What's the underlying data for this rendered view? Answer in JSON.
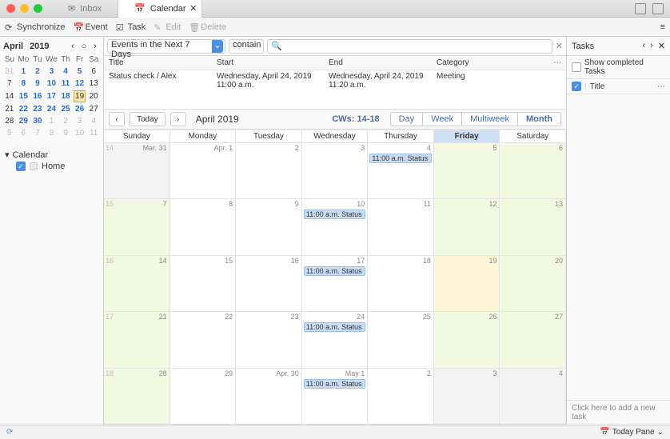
{
  "tabs": {
    "inbox": "Inbox",
    "calendar": "Calendar"
  },
  "toolbar": {
    "sync": "Synchronize",
    "event": "Event",
    "task": "Task",
    "edit": "Edit",
    "delete": "Delete"
  },
  "mini": {
    "month": "April",
    "year": "2019",
    "dow": [
      "Su",
      "Mo",
      "Tu",
      "We",
      "Th",
      "Fr",
      "Sa"
    ],
    "rows": [
      [
        {
          "d": "31",
          "dim": true
        },
        {
          "d": "1",
          "blue": true
        },
        {
          "d": "2",
          "blue": true
        },
        {
          "d": "3",
          "blue": true
        },
        {
          "d": "4",
          "blue": true
        },
        {
          "d": "5",
          "blue": true
        },
        {
          "d": "6"
        }
      ],
      [
        {
          "d": "7"
        },
        {
          "d": "8",
          "blue": true
        },
        {
          "d": "9",
          "blue": true
        },
        {
          "d": "10",
          "blue": true
        },
        {
          "d": "11",
          "blue": true
        },
        {
          "d": "12",
          "blue": true
        },
        {
          "d": "13"
        }
      ],
      [
        {
          "d": "14"
        },
        {
          "d": "15",
          "blue": true
        },
        {
          "d": "16",
          "blue": true
        },
        {
          "d": "17",
          "blue": true
        },
        {
          "d": "18",
          "blue": true
        },
        {
          "d": "19",
          "today": true
        },
        {
          "d": "20"
        }
      ],
      [
        {
          "d": "21"
        },
        {
          "d": "22",
          "blue": true
        },
        {
          "d": "23",
          "blue": true
        },
        {
          "d": "24",
          "blue": true
        },
        {
          "d": "25",
          "blue": true
        },
        {
          "d": "26",
          "blue": true
        },
        {
          "d": "27"
        }
      ],
      [
        {
          "d": "28"
        },
        {
          "d": "29",
          "blue": true
        },
        {
          "d": "30",
          "blue": true
        },
        {
          "d": "1",
          "dim": true
        },
        {
          "d": "2",
          "dim": true
        },
        {
          "d": "3",
          "dim": true
        },
        {
          "d": "4",
          "dim": true
        }
      ],
      [
        {
          "d": "5",
          "dim": true
        },
        {
          "d": "6",
          "dim": true
        },
        {
          "d": "7",
          "dim": true
        },
        {
          "d": "8",
          "dim": true
        },
        {
          "d": "9",
          "dim": true
        },
        {
          "d": "10",
          "dim": true
        },
        {
          "d": "11",
          "dim": true
        }
      ]
    ]
  },
  "sidebar": {
    "calendar_label": "Calendar",
    "home": "Home"
  },
  "filter": {
    "range": "Events in the Next 7 Days",
    "op": "contain",
    "search_placeholder": ""
  },
  "evlist": {
    "headers": {
      "title": "Title",
      "start": "Start",
      "end": "End",
      "category": "Category"
    },
    "rows": [
      {
        "title": "Status check / Alex",
        "start": "Wednesday, April 24, 2019 11:00 a.m.",
        "end": "Wednesday, April 24, 2019 11:20 a.m.",
        "category": "Meeting"
      }
    ]
  },
  "nav": {
    "today": "Today",
    "month_label": "April 2019",
    "cw": "CWs: 14-18",
    "views": {
      "day": "Day",
      "week": "Week",
      "multiweek": "Multiweek",
      "month": "Month"
    }
  },
  "grid": {
    "dow": [
      "Sunday",
      "Monday",
      "Tuesday",
      "Wednesday",
      "Thursday",
      "Friday",
      "Saturday"
    ],
    "weeks": [
      {
        "wn": "14",
        "cells": [
          {
            "d": "Mar. 31",
            "dim": true
          },
          {
            "d": "Apr. 1"
          },
          {
            "d": "2"
          },
          {
            "d": "3"
          },
          {
            "d": "4",
            "ev": "11:00 a.m. Status …"
          },
          {
            "d": "5",
            "green": true
          },
          {
            "d": "6",
            "green": true
          }
        ]
      },
      {
        "wn": "15",
        "cells": [
          {
            "d": "7",
            "green": true
          },
          {
            "d": "8"
          },
          {
            "d": "9"
          },
          {
            "d": "10",
            "ev": "11:00 a.m. Status …"
          },
          {
            "d": "11"
          },
          {
            "d": "12",
            "green": true
          },
          {
            "d": "13",
            "green": true
          }
        ]
      },
      {
        "wn": "16",
        "cells": [
          {
            "d": "14",
            "green": true
          },
          {
            "d": "15"
          },
          {
            "d": "16"
          },
          {
            "d": "17",
            "ev": "11:00 a.m. Status …"
          },
          {
            "d": "18"
          },
          {
            "d": "19",
            "today": true
          },
          {
            "d": "20",
            "green": true
          }
        ]
      },
      {
        "wn": "17",
        "cells": [
          {
            "d": "21",
            "green": true
          },
          {
            "d": "22"
          },
          {
            "d": "23"
          },
          {
            "d": "24",
            "ev": "11:00 a.m. Status …"
          },
          {
            "d": "25"
          },
          {
            "d": "26",
            "green": true
          },
          {
            "d": "27",
            "green": true
          }
        ]
      },
      {
        "wn": "18",
        "cells": [
          {
            "d": "28",
            "green": true
          },
          {
            "d": "29"
          },
          {
            "d": "Apr. 30"
          },
          {
            "d": "May 1",
            "ev": "11:00 a.m. Status …"
          },
          {
            "d": "2"
          },
          {
            "d": "3",
            "dim": true
          },
          {
            "d": "4",
            "dim": true
          }
        ]
      }
    ]
  },
  "tasks": {
    "title": "Tasks",
    "show_completed": "Show completed Tasks",
    "col_title": "Title",
    "add_hint": "Click here to add a new task"
  },
  "status": {
    "today_pane": "Today Pane"
  }
}
